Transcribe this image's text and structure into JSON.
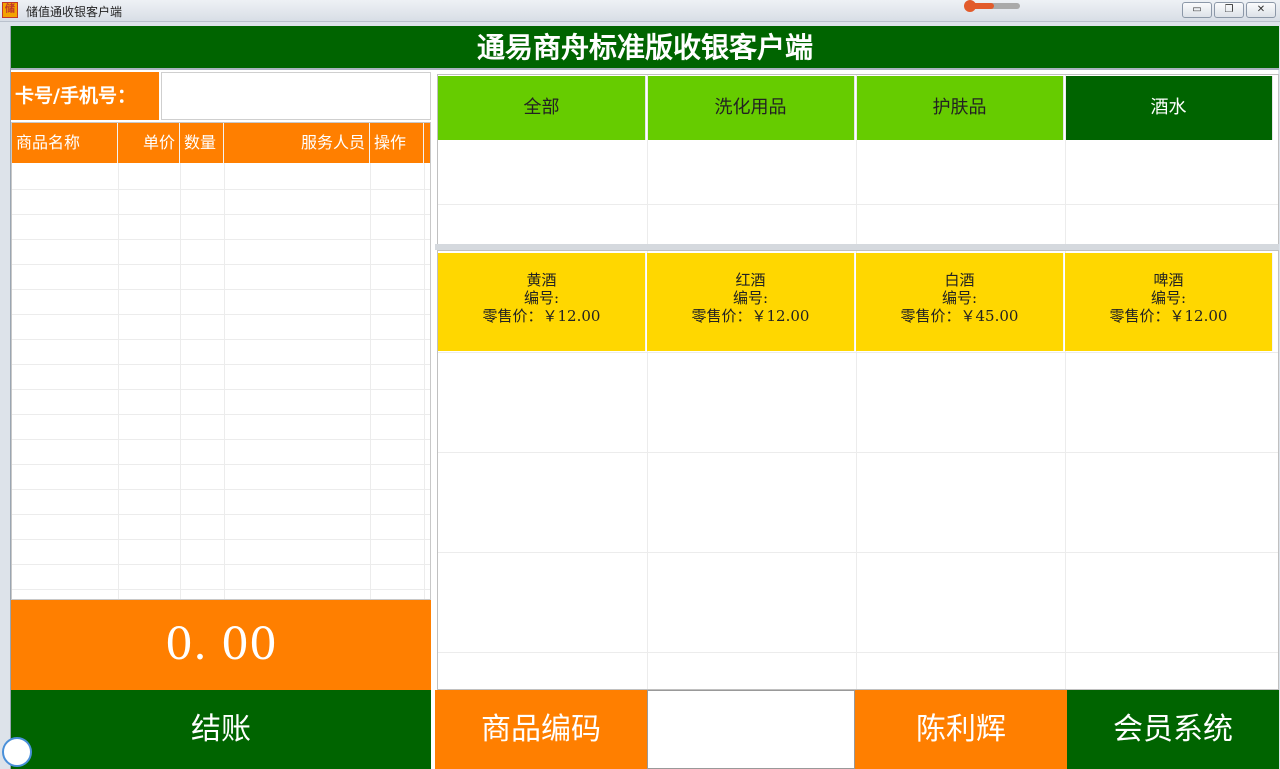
{
  "window": {
    "title": "储值通收银客户端",
    "icon_glyph": "储"
  },
  "header": {
    "title": "通易商舟标准版收银客户端"
  },
  "card": {
    "label": "卡号/手机号：",
    "value": ""
  },
  "table": {
    "columns": [
      "商品名称",
      "单价",
      "数量",
      "服务人员",
      "操作"
    ]
  },
  "total": {
    "amount": "0. 00"
  },
  "actions": {
    "checkout": "结账",
    "product_code": "商品编码",
    "product_code_value": "",
    "staff": "陈利辉",
    "member": "会员系统"
  },
  "categories": [
    {
      "label": "全部",
      "active": false
    },
    {
      "label": "洗化用品",
      "active": false
    },
    {
      "label": "护肤品",
      "active": false
    },
    {
      "label": "酒水",
      "active": true
    }
  ],
  "products": [
    {
      "name": "黄酒",
      "code_label": "编号:",
      "price_label": "零售价：￥12.00"
    },
    {
      "name": "红酒",
      "code_label": "编号:",
      "price_label": "零售价：￥12.00"
    },
    {
      "name": "白酒",
      "code_label": "编号:",
      "price_label": "零售价：￥45.00"
    },
    {
      "name": "啤酒",
      "code_label": "编号:",
      "price_label": "零售价：￥12.00"
    }
  ],
  "colors": {
    "dark_green": "#006400",
    "light_green": "#66cc00",
    "orange": "#ff7f00",
    "yellow": "#ffd700"
  },
  "icons": [
    "minimize-icon",
    "restore-icon",
    "close-icon"
  ]
}
